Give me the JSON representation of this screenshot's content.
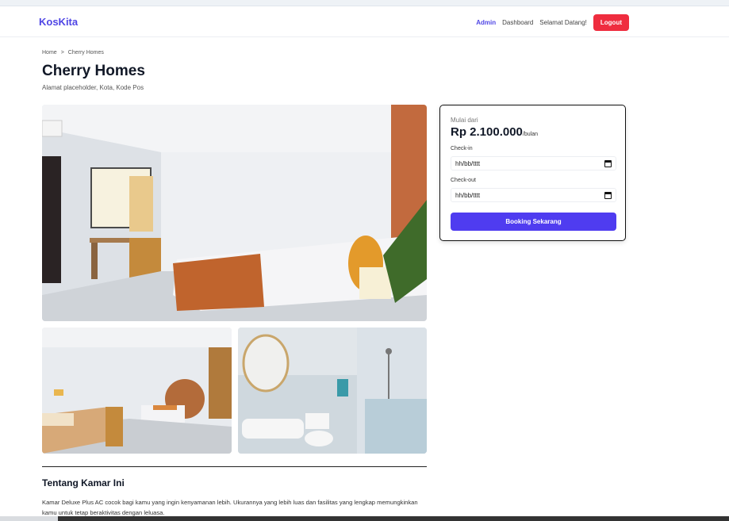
{
  "navbar": {
    "brand": "KosKita",
    "links": [
      "Admin",
      "Dashboard"
    ],
    "greeting": "Selamat Datang!",
    "logout_label": "Logout"
  },
  "breadcrumb": {
    "home": "Home",
    "separator": ">",
    "current": "Cherry Homes"
  },
  "property": {
    "title": "Cherry Homes",
    "address": "Alamat placeholder, Kota, Kode Pos"
  },
  "booking": {
    "price_from_label": "Mulai dari",
    "price": "Rp 2.100.000",
    "price_unit": "/bulan",
    "checkin_label": "Check-in",
    "checkin_value": "hh/bb/tttt",
    "checkout_label": "Check-out",
    "checkout_value": "hh/bb/tttt",
    "button_label": "Booking Sekarang"
  },
  "about": {
    "title": "Tentang Kamar Ini",
    "description": "Kamar Deluxe Plus AC cocok bagi kamu yang ingin kenyamanan lebih. Ukurannya yang lebih luas dan fasilitas yang lengkap memungkinkan kamu untuk tetap beraktivitas dengan leluasa."
  },
  "colors": {
    "accent": "#4f46e5",
    "button": "#4f3cf0",
    "logout": "#ef2d3f"
  }
}
